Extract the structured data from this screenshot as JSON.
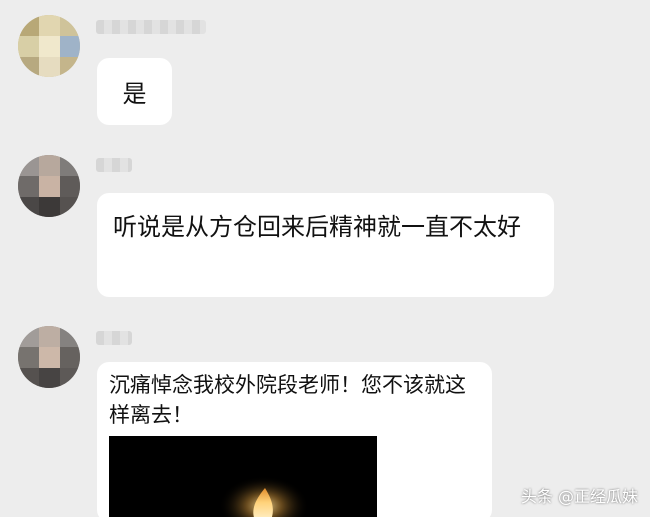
{
  "messages": [
    {
      "sender": "",
      "text": "是",
      "avatar": "blurred-cartoon-avatar"
    },
    {
      "sender": "",
      "text": "听说是从方仓回来后精神就一直不太好",
      "avatar": "blurred-photo-avatar"
    },
    {
      "sender": "",
      "text": "沉痛悼念我校外院段老师！您不该就这样离去！",
      "avatar": "blurred-photo-avatar",
      "media": "candle-video-thumbnail"
    }
  ],
  "watermark": "头条 @正经瓜妹",
  "colors": {
    "background": "#ededed",
    "bubble": "#ffffff",
    "text": "#111111"
  }
}
